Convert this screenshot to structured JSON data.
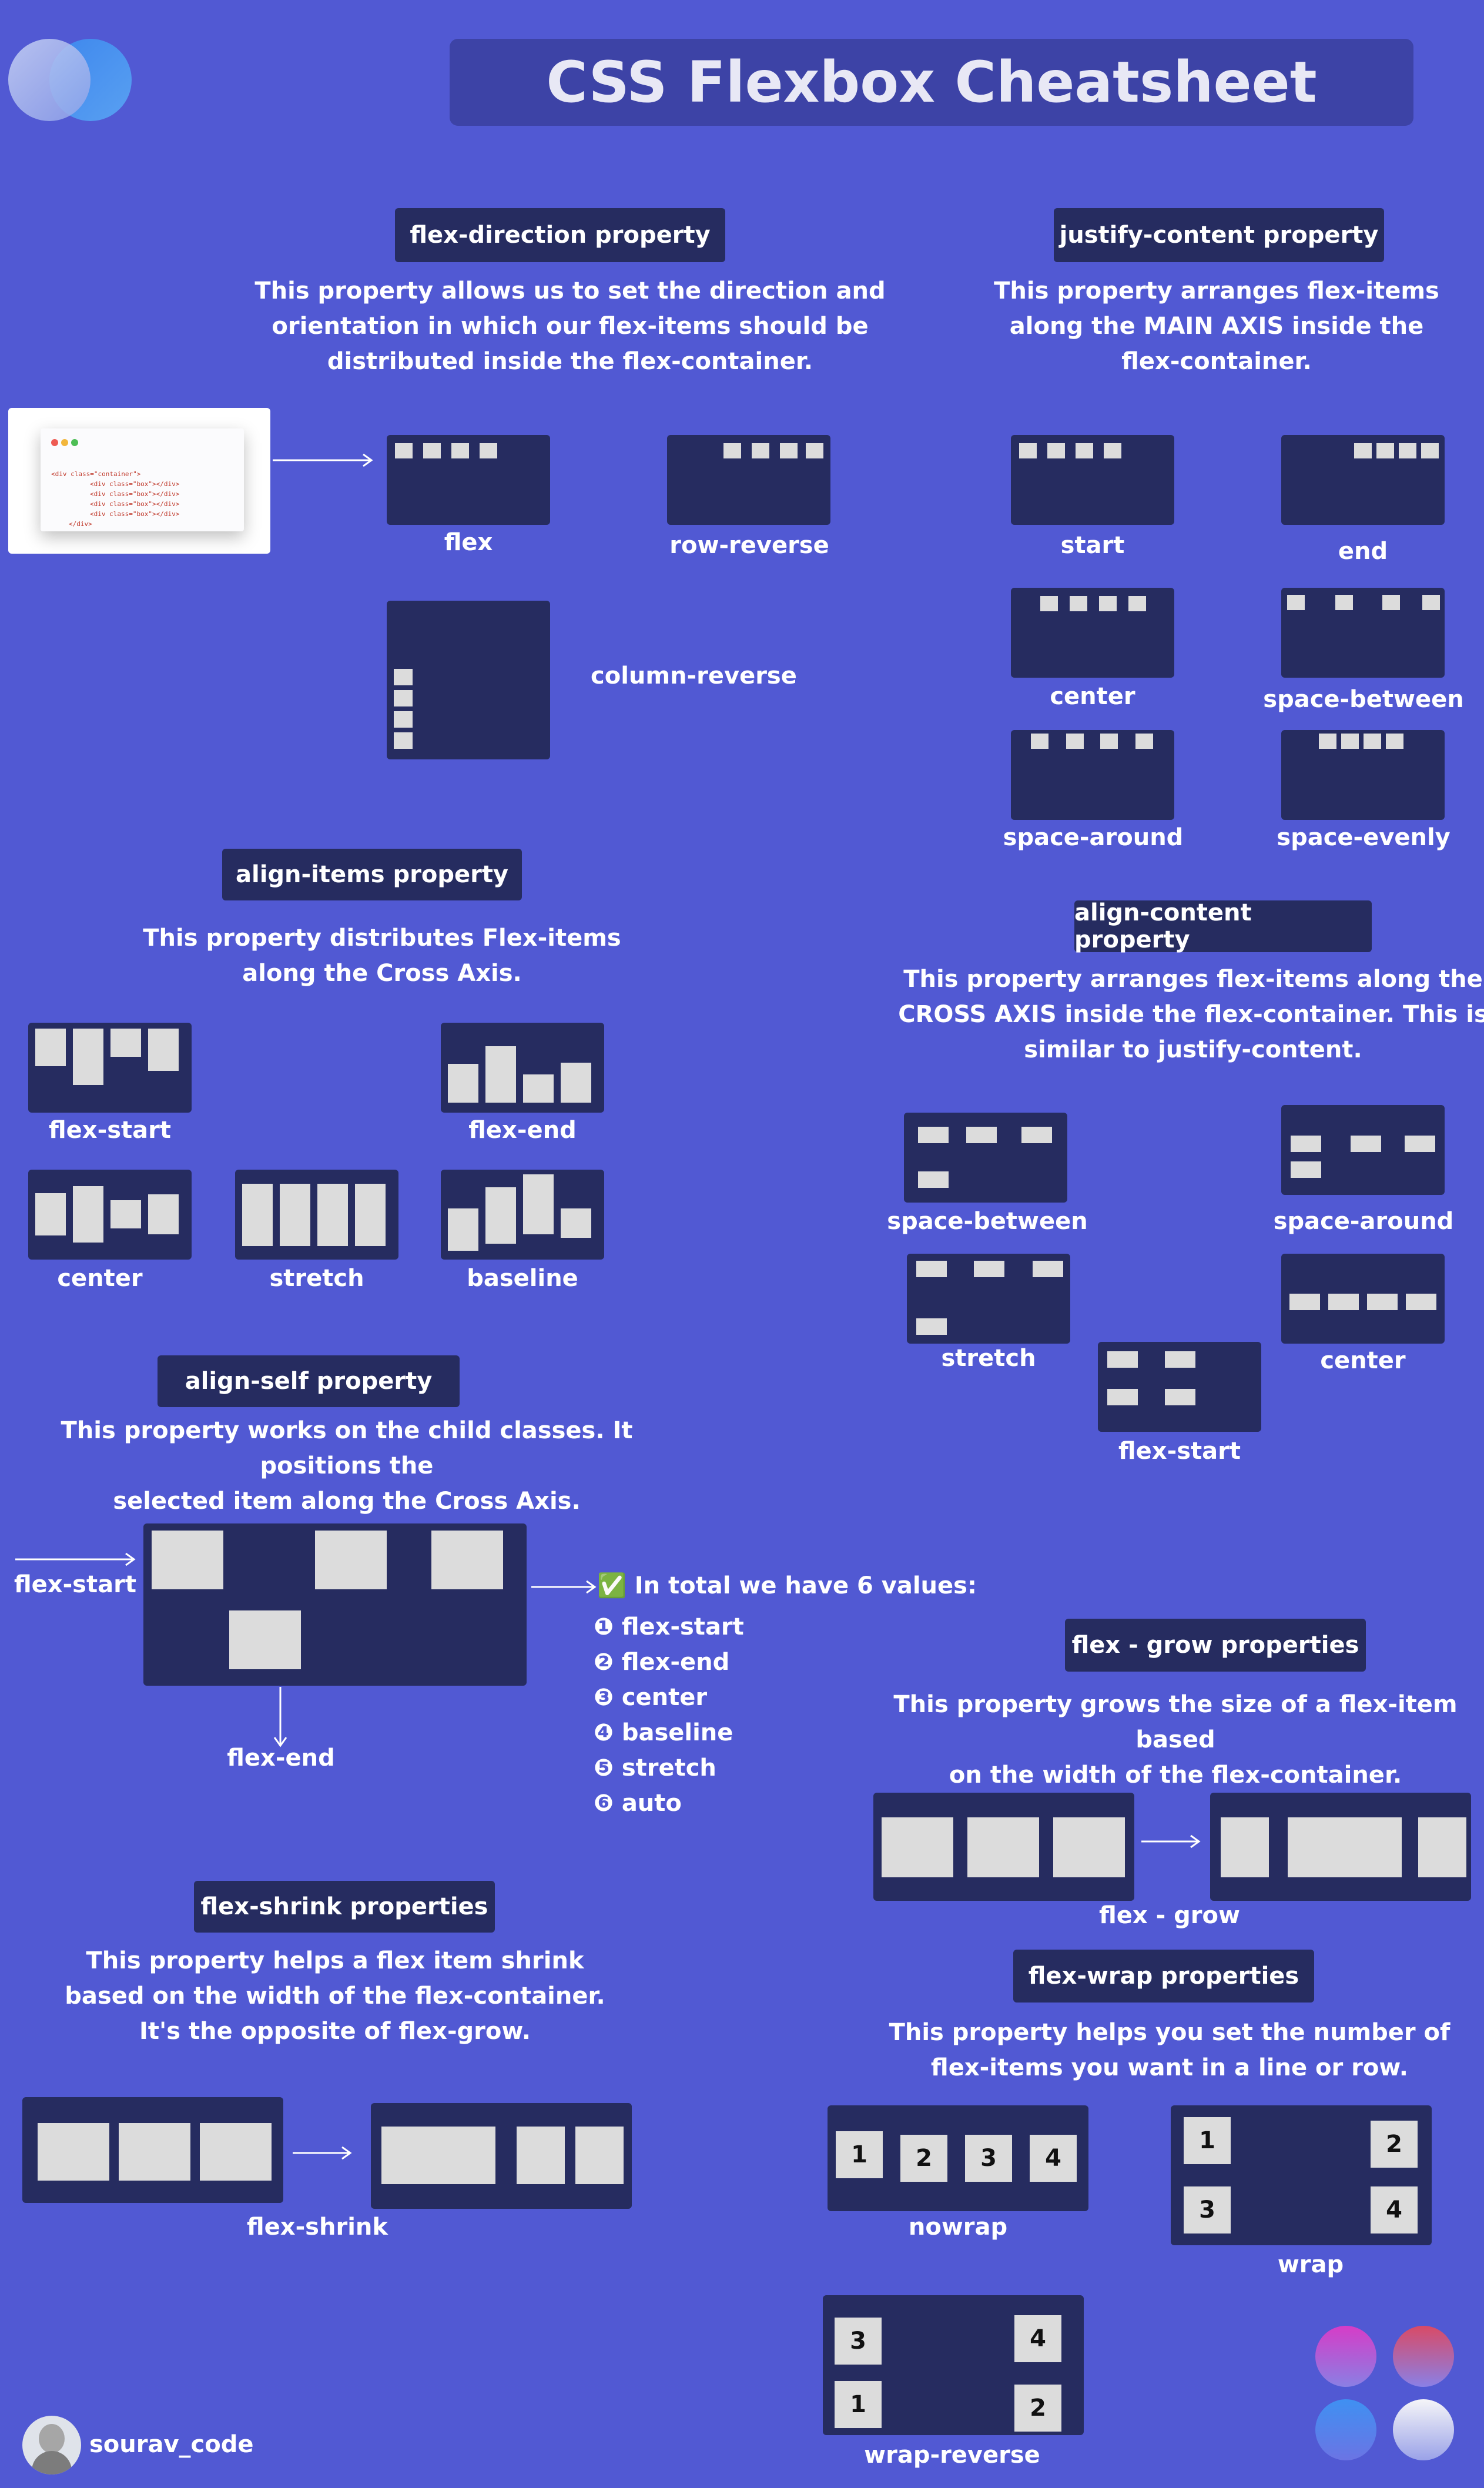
{
  "header": {
    "title": "CSS Flexbox Cheatsheet"
  },
  "flex_direction": {
    "heading": "flex-direction property",
    "desc": [
      "This property allows us to set the direction and",
      "orientation in which our flex-items should be",
      "distributed inside the flex-container."
    ],
    "code": {
      "open": "<div class=\"container\">",
      "child": "<div class=\"box\"></div>",
      "close": "</div>"
    },
    "labels": [
      "flex",
      "row-reverse",
      "column-reverse"
    ]
  },
  "justify_content": {
    "heading": "justify-content property",
    "desc": [
      "This property arranges flex-items",
      "along the MAIN AXIS inside the",
      "flex-container."
    ],
    "labels": [
      "start",
      "end",
      "center",
      "space-between",
      "space-around",
      "space-evenly"
    ]
  },
  "align_items": {
    "heading": "align-items property",
    "desc": [
      "This property distributes Flex-items",
      "along the Cross Axis."
    ],
    "labels": [
      "flex-start",
      "flex-end",
      "center",
      "stretch",
      "baseline"
    ]
  },
  "align_content": {
    "heading": "align-content property",
    "desc": [
      "This property arranges flex-items along the",
      "CROSS AXIS inside the flex-container. This is",
      "similar to justify-content."
    ],
    "labels": [
      "space-between",
      "space-around",
      "stretch",
      "center",
      "flex-start"
    ]
  },
  "align_self": {
    "heading": "align-self property",
    "desc": [
      "This property works on the child classes. It positions the",
      "selected item along the Cross Axis."
    ],
    "label_start": "flex-start",
    "label_end": "flex-end",
    "values_intro": "In total we have 6 values:",
    "values": [
      "flex-start",
      "flex-end",
      "center",
      "baseline",
      "stretch",
      "auto"
    ],
    "markers": [
      "❶",
      "❷",
      "❸",
      "❹",
      "❺",
      "❻"
    ],
    "check": "✅"
  },
  "flex_grow": {
    "heading": "flex - grow properties",
    "desc": [
      "This property grows the size of a flex-item based",
      "on the width of the flex-container."
    ],
    "label": "flex - grow"
  },
  "flex_shrink": {
    "heading": "flex-shrink  properties",
    "desc": [
      "This property helps a flex item shrink",
      "based on the width of the flex-container.",
      "It's the opposite of flex-grow."
    ],
    "label": "flex-shrink"
  },
  "flex_wrap": {
    "heading": "flex-wrap properties",
    "desc": [
      "This property helps you set the number of",
      "flex-items you want in a line or row."
    ],
    "labels": [
      "nowrap",
      "wrap",
      "wrap-reverse"
    ],
    "nowrap_items": [
      "1",
      "2",
      "3",
      "4"
    ],
    "wrap_items": [
      "1",
      "2",
      "3",
      "4"
    ],
    "wrap_reverse_items": [
      "3",
      "4",
      "1",
      "2"
    ]
  },
  "footer": {
    "author": "sourav_code"
  },
  "colors": {
    "background": "#5159d3",
    "panel": "#262c60",
    "item": "#dcdcdc"
  }
}
